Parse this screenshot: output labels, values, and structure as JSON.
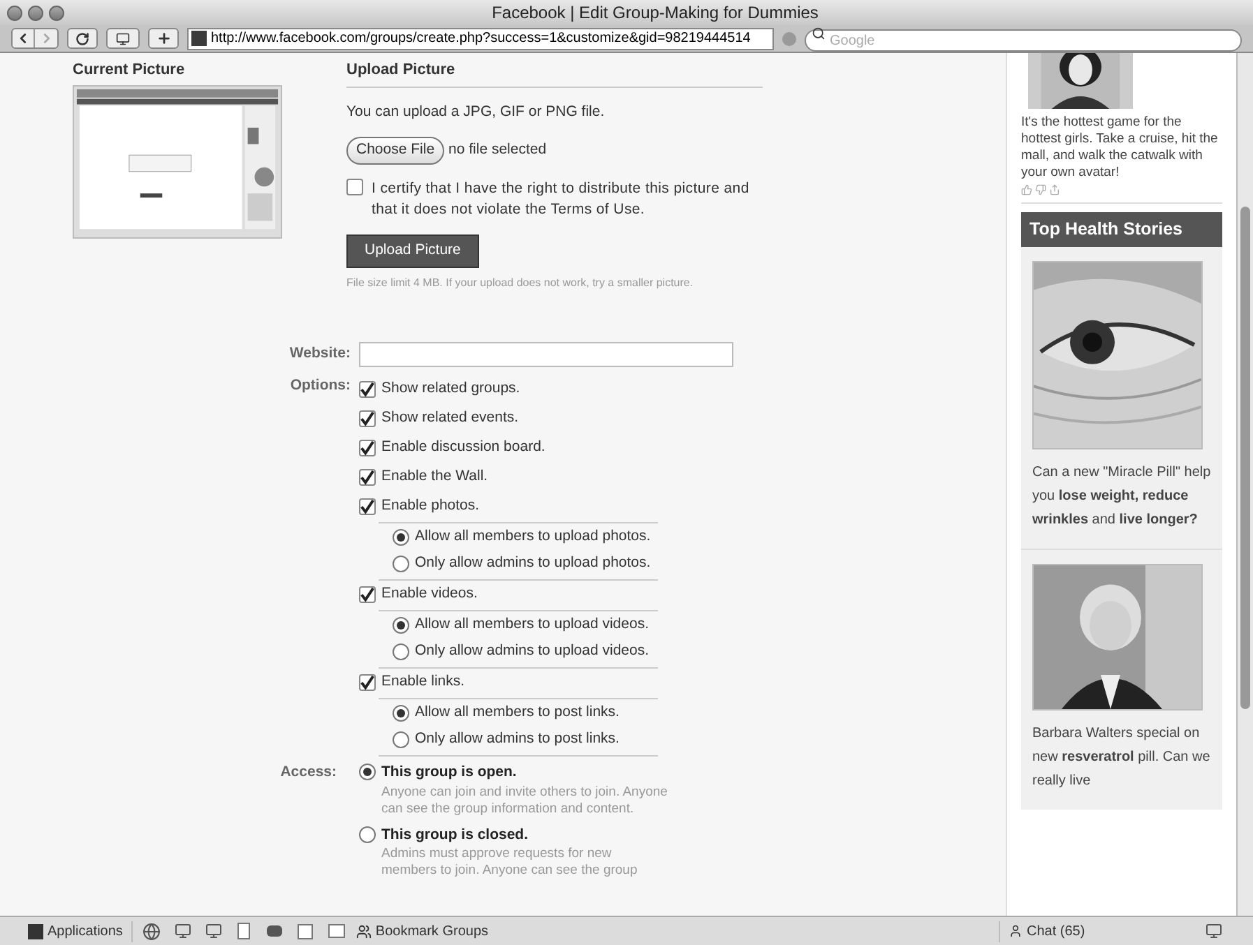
{
  "window": {
    "title": "Facebook | Edit Group-Making for Dummies"
  },
  "toolbar": {
    "url": "http://www.facebook.com/groups/create.php?success=1&customize&gid=98219444514",
    "search_placeholder": "Google"
  },
  "current_picture": {
    "heading": "Current Picture"
  },
  "upload": {
    "heading": "Upload Picture",
    "hint": "You can upload a JPG, GIF or PNG file.",
    "choose_button": "Choose File",
    "file_status": "no file selected",
    "certify": {
      "label": "I certify that I have the right to distribute this picture and that it does not violate the Terms of Use.",
      "checked": false
    },
    "upload_button": "Upload Picture",
    "size_note": "File size limit 4 MB. If your upload does not work, try a smaller picture."
  },
  "website": {
    "label": "Website:"
  },
  "options": {
    "label": "Options:",
    "items": [
      {
        "label": "Show related groups.",
        "checked": true
      },
      {
        "label": "Show related events.",
        "checked": true
      },
      {
        "label": "Enable discussion board.",
        "checked": true
      },
      {
        "label": "Enable the Wall.",
        "checked": true
      },
      {
        "label": "Enable photos.",
        "checked": true,
        "choices": [
          {
            "label": "Allow all members to upload photos.",
            "selected": true
          },
          {
            "label": "Only allow admins to upload photos.",
            "selected": false
          }
        ]
      },
      {
        "label": "Enable videos.",
        "checked": true,
        "choices": [
          {
            "label": "Allow all members to upload videos.",
            "selected": true
          },
          {
            "label": "Only allow admins to upload videos.",
            "selected": false
          }
        ]
      },
      {
        "label": "Enable links.",
        "checked": true,
        "choices": [
          {
            "label": "Allow all members to post links.",
            "selected": true
          },
          {
            "label": "Only allow admins to post links.",
            "selected": false
          }
        ]
      }
    ]
  },
  "access": {
    "label": "Access:",
    "items": [
      {
        "title": "This group is open.",
        "description": "Anyone can join and invite others to join. Anyone can see the group information and content.",
        "selected": true
      },
      {
        "title": "This group is closed.",
        "description": "Admins must approve requests for new members to join. Anyone can see the group",
        "selected": false
      }
    ]
  },
  "sidebar": {
    "ad_text": "It's the hottest game for the hottest girls. Take a cruise, hit the mall, and walk the catwalk with your own avatar!",
    "heading": "Top Health Stories",
    "stories": [
      {
        "text": "Can a new \"Miracle Pill\" help you **lose weight, reduce wrinkles** and **live longer?**"
      },
      {
        "text": "Barbara Walters special on new **resveratrol** pill. Can we really live"
      }
    ]
  },
  "bottom_bar": {
    "applications": "Applications",
    "bookmark": "Bookmark Groups",
    "chat": "Chat (65)"
  }
}
